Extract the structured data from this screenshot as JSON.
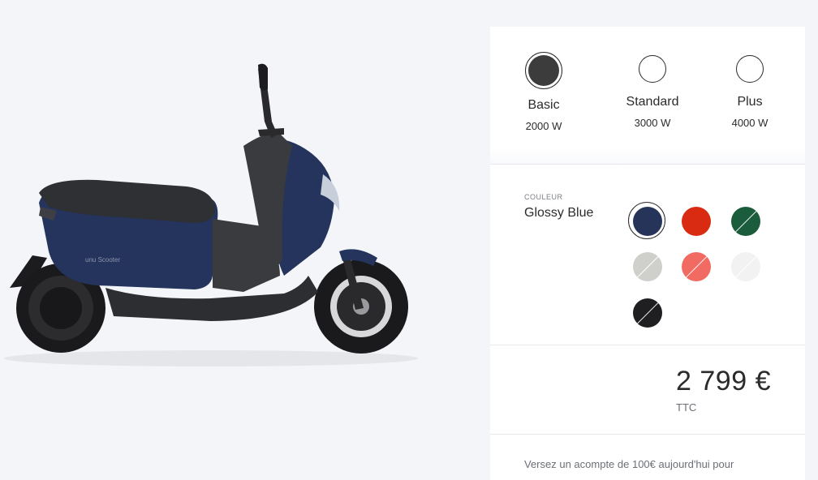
{
  "versions": [
    {
      "name": "Basic",
      "power": "2000 W",
      "selected": true
    },
    {
      "name": "Standard",
      "power": "3000 W",
      "selected": false
    },
    {
      "name": "Plus",
      "power": "4000 W",
      "selected": false
    }
  ],
  "color": {
    "label": "COULEUR",
    "selected_name": "Glossy Blue",
    "swatches": [
      {
        "color": "#27345a",
        "selected": true,
        "slashed": false
      },
      {
        "color": "#d92b12",
        "selected": false,
        "slashed": false
      },
      {
        "color": "#1a5c3c",
        "selected": false,
        "slashed": true
      },
      {
        "color": "#cfd0cc",
        "selected": false,
        "slashed": true
      },
      {
        "color": "#f26b62",
        "selected": false,
        "slashed": true
      },
      {
        "color": "#f2f2f2",
        "selected": false,
        "slashed": true
      },
      {
        "color": "#1f1f21",
        "selected": false,
        "slashed": true
      }
    ]
  },
  "price": {
    "amount": "2 799 €",
    "tax": "TTC"
  },
  "deposit": {
    "text": "Versez un acompte de 100€ aujourd'hui pour"
  },
  "product": {
    "brand_mark": "unu Scooter",
    "body_color": "#25345c"
  }
}
